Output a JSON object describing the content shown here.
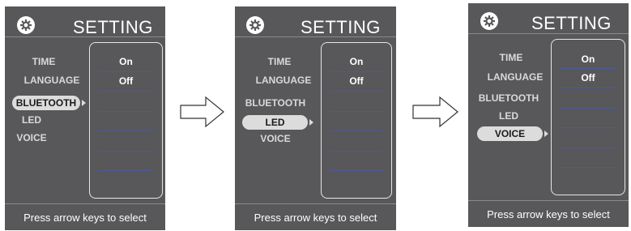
{
  "screens": [
    {
      "title": "SETTING",
      "menu": [
        "TIME",
        "LANGUAGE",
        "BLUETOOTH",
        "LED",
        "VOICE"
      ],
      "selected_index": 2,
      "values": [
        "On",
        "Off"
      ],
      "hint": "Press arrow keys to select"
    },
    {
      "title": "SETTING",
      "menu": [
        "TIME",
        "LANGUAGE",
        "BLUETOOTH",
        "LED",
        "VOICE"
      ],
      "selected_index": 3,
      "values": [
        "On",
        "Off"
      ],
      "hint": "Press arrow keys to select"
    },
    {
      "title": "SETTING",
      "menu": [
        "TIME",
        "LANGUAGE",
        "BLUETOOTH",
        "LED",
        "VOICE"
      ],
      "selected_index": 4,
      "values": [
        "On",
        "Off"
      ],
      "hint": "Press arrow keys to select"
    }
  ],
  "colors": {
    "panel_bg": "#58585a",
    "pill_bg": "#dcdcdc",
    "text": "#ffffff",
    "menu_text": "#d9d9d9"
  },
  "icons": {
    "header": "gear-icon",
    "transition": "right-arrow-icon"
  }
}
